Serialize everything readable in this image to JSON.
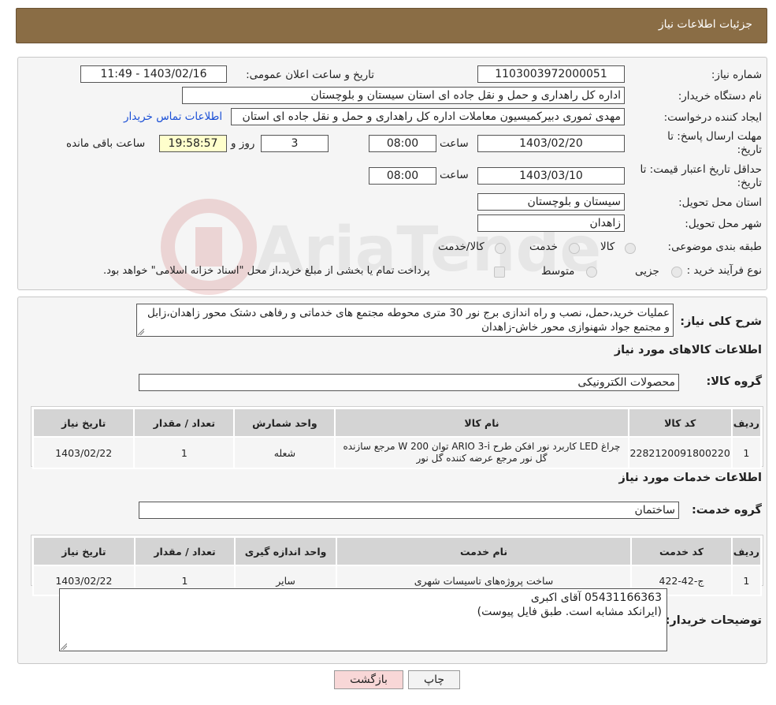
{
  "header": {
    "title": "جزئیات اطلاعات نیاز"
  },
  "form": {
    "need_number_label": "شماره نیاز:",
    "need_number": "1103003972000051",
    "announce_label": "تاریخ و ساعت اعلان عمومی:",
    "announce_value": "1403/02/16 - 11:49",
    "buyer_org_label": "نام دستگاه خریدار:",
    "buyer_org": "اداره کل راهداری و حمل و نقل جاده ای استان سیستان و بلوچستان",
    "creator_label": "ایجاد کننده درخواست:",
    "creator": "مهدی ثموری دبیرکمیسیون معاملات اداره کل راهداری و حمل و نقل جاده ای استان",
    "contact_link": "اطلاعات تماس خریدار",
    "deadline_label_1": "مهلت ارسال پاسخ: تا",
    "deadline_label_2": "تاریخ:",
    "deadline_date": "1403/02/20",
    "time_word": "ساعت",
    "deadline_time": "08:00",
    "days_value": "3",
    "days_word": "روز و",
    "remaining_time": "19:58:57",
    "remaining_word": "ساعت باقی مانده",
    "validity_label_1": "حداقل تاریخ اعتبار قیمت: تا",
    "validity_label_2": "تاریخ:",
    "validity_date": "1403/03/10",
    "validity_time": "08:00",
    "province_label": "استان محل تحویل:",
    "province": "سیستان و بلوچستان",
    "city_label": "شهر محل تحویل:",
    "city": "زاهدان",
    "category_label": "طبقه بندی موضوعی:",
    "category_options": [
      "کالا",
      "خدمت",
      "کالا/خدمت"
    ],
    "process_label": "نوع فرآیند خرید :",
    "process_options": [
      "جزیی",
      "متوسط"
    ],
    "payment_note": "پرداخت تمام یا بخشی از مبلغ خرید،از محل \"اسناد خزانه اسلامی\" خواهد بود."
  },
  "description": {
    "label": "شرح کلی نیاز:",
    "text": "عملیات خرید،حمل، نصب و راه اندازی برج نور 30 متری محوطه مجتمع های خدماتی و رفاهی دشتک محور زاهدان،زابل و مجتمع جواد شهنوازی محور خاش-زاهدان"
  },
  "goods": {
    "section_title": "اطلاعات کالاهای مورد نیاز",
    "group_label": "گروه کالا:",
    "group_value": "محصولات الکترونیکی",
    "columns": [
      "ردیف",
      "کد کالا",
      "نام کالا",
      "واحد شمارش",
      "تعداد / مقدار",
      "تاریخ نیاز"
    ],
    "rows": [
      [
        "1",
        "2282120091800220",
        "چراغ LED کاربرد نور افکن طرح ARIO 3-i توان W 200 مرجع سازنده گل نور مرجع عرضه کننده گل نور",
        "شعله",
        "1",
        "1403/02/22"
      ]
    ]
  },
  "services": {
    "section_title": "اطلاعات خدمات مورد نیاز",
    "group_label": "گروه خدمت:",
    "group_value": "ساختمان",
    "columns": [
      "ردیف",
      "کد خدمت",
      "نام خدمت",
      "واحد اندازه گیری",
      "تعداد / مقدار",
      "تاریخ نیاز"
    ],
    "rows": [
      [
        "1",
        "ج-42-422",
        "ساخت پروژه‌های تاسیسات شهری",
        "سایر",
        "1",
        "1403/02/22"
      ]
    ]
  },
  "buyer_notes": {
    "label": "توضیحات خریدار:",
    "line1": "05431166363 آقای اکبری",
    "line2": "(ایرانکد مشابه است. طبق فایل پیوست)"
  },
  "buttons": {
    "print": "چاپ",
    "back": "بازگشت"
  },
  "watermark": {
    "text": "AriaTender.neT"
  },
  "colors": {
    "header_bg": "#8a6d45",
    "link": "#1a4fd6",
    "back_button": "#f8d7d7",
    "yellow_field": "#ffffcc"
  }
}
